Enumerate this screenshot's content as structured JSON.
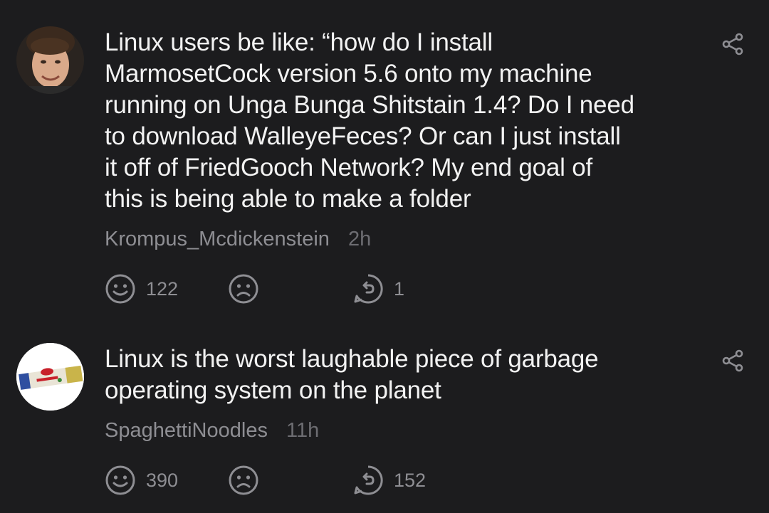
{
  "comments": [
    {
      "text": "Linux users be like: “how do I install\nMarmosetCock version 5.6 onto my machine\nrunning on Unga Bunga Shitstain 1.4? Do I need\nto download WalleyeFeces? Or can I just install\nit off of FriedGooch Network? My end goal of\nthis is being able to make a folder",
      "username": "Krompus_Mcdickenstein",
      "time": "2h",
      "likes": "122",
      "replies": "1",
      "avatar_icon": "user-photo-avatar"
    },
    {
      "text": "Linux is the worst laughable piece of garbage\noperating system on the planet",
      "username": "SpaghettiNoodles",
      "time": "11h",
      "likes": "390",
      "replies": "152",
      "avatar_icon": "spaghetti-box-avatar"
    }
  ],
  "colors": {
    "background": "#1c1c1e",
    "text": "#f2f2f2",
    "meta": "#8e8e93",
    "icon": "#8e8e93"
  }
}
